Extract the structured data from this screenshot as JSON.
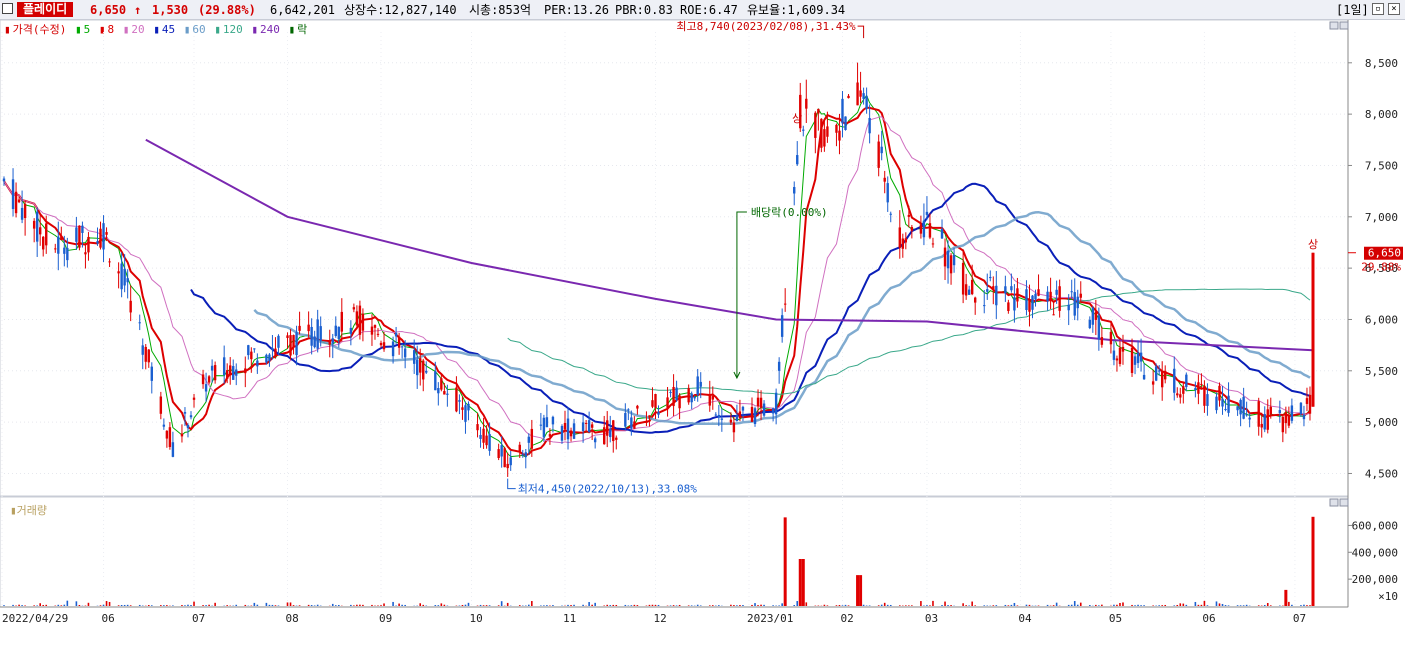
{
  "header": {
    "stock_name": "플레이디",
    "price": "6,650",
    "change_arrow": "↑",
    "change": "1,530",
    "change_pct": "(29.88%)",
    "volume": "6,642,201",
    "shares": "상장수:12,827,140",
    "market_cap": "시총:853억",
    "per": "PER:13.26",
    "pbr": "PBR:0.83",
    "roe": "ROE:6.47",
    "float": "유보율:1,609.34",
    "period": "[1일]"
  },
  "legend": {
    "price_label": "가격(수정)",
    "ma_labels": [
      "5",
      "8",
      "20",
      "45",
      "60",
      "120",
      "240"
    ],
    "ex_label": "락"
  },
  "volume_legend": "거래량",
  "colors": {
    "up": "#e00000",
    "down": "#1a5fd0",
    "ma5": "#00aa00",
    "ma8": "#dd0000",
    "ma20": "#d070c0",
    "ma45": "#0a1fb8",
    "ma60": "#6a9cc8",
    "ma120": "#3aa88a",
    "ma240": "#7a28b0"
  },
  "chart_data": {
    "type": "candlestick",
    "ylim": [
      4300,
      8800
    ],
    "y_ticks": [
      "8,500",
      "8,000",
      "7,500",
      "7,000",
      "6,500",
      "6,000",
      "5,500",
      "5,000",
      "4,500"
    ],
    "y_tick_values": [
      8500,
      8000,
      7500,
      7000,
      6500,
      6000,
      5500,
      5000,
      4500
    ],
    "x_labels": [
      "2022/04/29",
      "06",
      "07",
      "08",
      "09",
      "10",
      "11",
      "12",
      "2023/01",
      "02",
      "03",
      "04",
      "05",
      "06",
      "07"
    ],
    "current_price": "6,650",
    "current_pct": "29.88%",
    "annotations": {
      "high": "최고8,740(2023/02/08),31.43%",
      "low": "최저4,450(2022/10/13),33.08%",
      "dividend": "배당락(0.00%)",
      "limit_up_1": "상",
      "limit_up_2": "상"
    },
    "price_keypoints": [
      {
        "date": "2022/04/29",
        "close": 7350
      },
      {
        "date": "2022/05/15",
        "close": 6700
      },
      {
        "date": "2022/06/01",
        "close": 6850
      },
      {
        "date": "2022/06/10",
        "close": 6200
      },
      {
        "date": "2022/06/24",
        "close": 4750
      },
      {
        "date": "2022/07/05",
        "close": 5400
      },
      {
        "date": "2022/07/20",
        "close": 5650
      },
      {
        "date": "2022/08/10",
        "close": 5850
      },
      {
        "date": "2022/08/25",
        "close": 6000
      },
      {
        "date": "2022/09/10",
        "close": 5650
      },
      {
        "date": "2022/09/25",
        "close": 5250
      },
      {
        "date": "2022/10/13",
        "close": 4600
      },
      {
        "date": "2022/10/25",
        "close": 4950
      },
      {
        "date": "2022/11/15",
        "close": 4900
      },
      {
        "date": "2022/12/01",
        "close": 5150
      },
      {
        "date": "2022/12/15",
        "close": 5350
      },
      {
        "date": "2022/12/27",
        "close": 5000
      },
      {
        "date": "2023/01/10",
        "close": 5200
      },
      {
        "date": "2023/01/13",
        "close": 6300
      },
      {
        "date": "2023/01/18",
        "close": 8000
      },
      {
        "date": "2023/01/27",
        "close": 7800
      },
      {
        "date": "2023/02/08",
        "close": 8200
      },
      {
        "date": "2023/02/20",
        "close": 6800
      },
      {
        "date": "2023/03/01",
        "close": 6950
      },
      {
        "date": "2023/03/15",
        "close": 6300
      },
      {
        "date": "2023/04/05",
        "close": 6200
      },
      {
        "date": "2023/04/20",
        "close": 6150
      },
      {
        "date": "2023/05/05",
        "close": 5650
      },
      {
        "date": "2023/05/25",
        "close": 5350
      },
      {
        "date": "2023/06/10",
        "close": 5200
      },
      {
        "date": "2023/06/25",
        "close": 5000
      },
      {
        "date": "2023/07/06",
        "close": 5150
      },
      {
        "date": "2023/07/07",
        "close": 6650
      }
    ],
    "ma240_keypoints": [
      {
        "date": "2022/06/15",
        "value": 7750
      },
      {
        "date": "2022/08/01",
        "value": 7000
      },
      {
        "date": "2022/10/01",
        "value": 6550
      },
      {
        "date": "2022/12/01",
        "value": 6200
      },
      {
        "date": "2023/01/10",
        "value": 6000
      },
      {
        "date": "2023/03/01",
        "value": 5980
      },
      {
        "date": "2023/05/01",
        "value": 5800
      },
      {
        "date": "2023/07/07",
        "value": 5700
      }
    ],
    "volume": {
      "ylim": [
        0,
        700000
      ],
      "y_ticks": [
        "600,000",
        "400,000",
        "200,000"
      ],
      "y_tick_values": [
        600000,
        400000,
        200000
      ],
      "unit": "×10",
      "spikes": [
        {
          "date": "2023/01/13",
          "value": 660000
        },
        {
          "date": "2023/01/18",
          "value": 350000
        },
        {
          "date": "2023/01/19",
          "value": 350000
        },
        {
          "date": "2023/02/06",
          "value": 230000
        },
        {
          "date": "2023/02/07",
          "value": 230000
        },
        {
          "date": "2023/06/28",
          "value": 120000
        },
        {
          "date": "2023/07/07",
          "value": 664220
        }
      ]
    }
  }
}
